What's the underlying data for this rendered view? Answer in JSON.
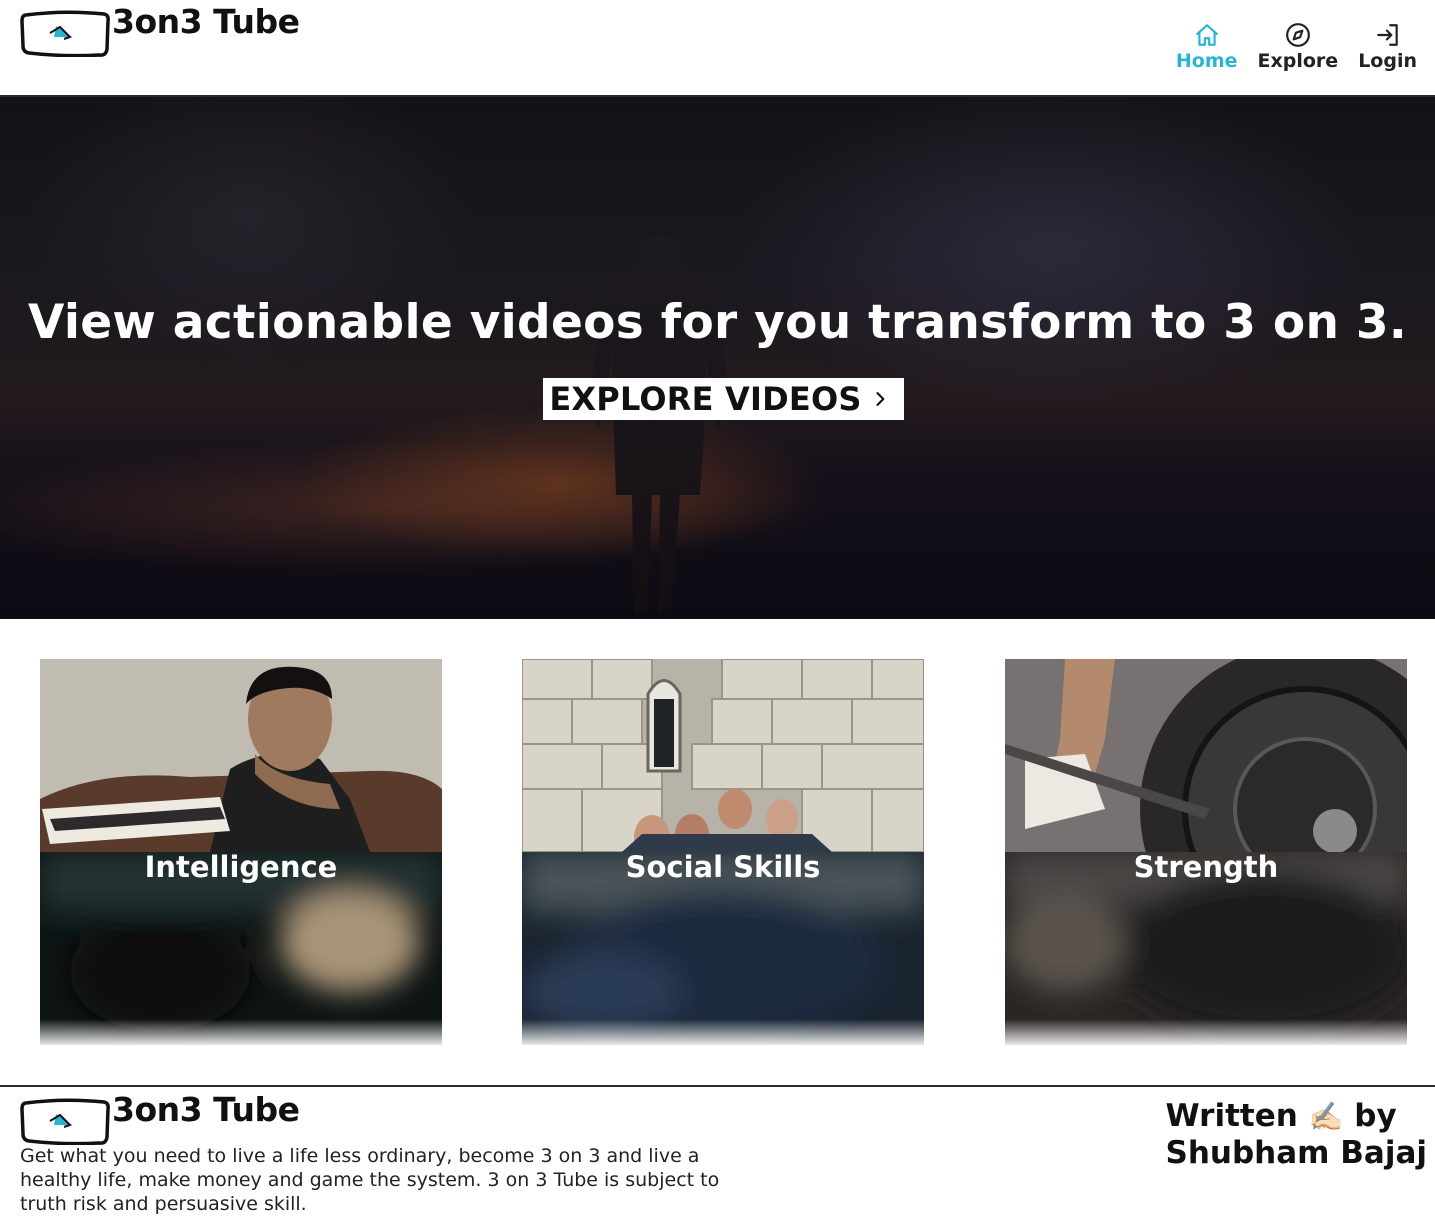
{
  "app": {
    "brand_name": "3on3 Tube"
  },
  "nav": {
    "items": [
      {
        "label": "Home",
        "icon": "home-icon",
        "active": true
      },
      {
        "label": "Explore",
        "icon": "compass-icon",
        "active": false
      },
      {
        "label": "Login",
        "icon": "login-icon",
        "active": false
      }
    ]
  },
  "hero": {
    "title": "View actionable videos for you transform to 3 on 3.",
    "cta_label": "EXPLORE VIDEOS"
  },
  "categories": [
    {
      "label": "Intelligence"
    },
    {
      "label": "Social Skills"
    },
    {
      "label": "Strength"
    }
  ],
  "footer": {
    "brand_name": "3on3 Tube",
    "description": "Get what you need to live a life less ordinary, become 3 on 3 and live a healthy life, make money and game the system. 3 on 3 Tube is subject to truth risk and persuasive skill.",
    "author_prefix": "Written",
    "author_emoji": "✍🏻",
    "author_by": "by",
    "author_name": "Shubham Bajaj"
  },
  "colors": {
    "accent": "#2bb3d6",
    "text": "#111111",
    "background": "#ffffff"
  }
}
